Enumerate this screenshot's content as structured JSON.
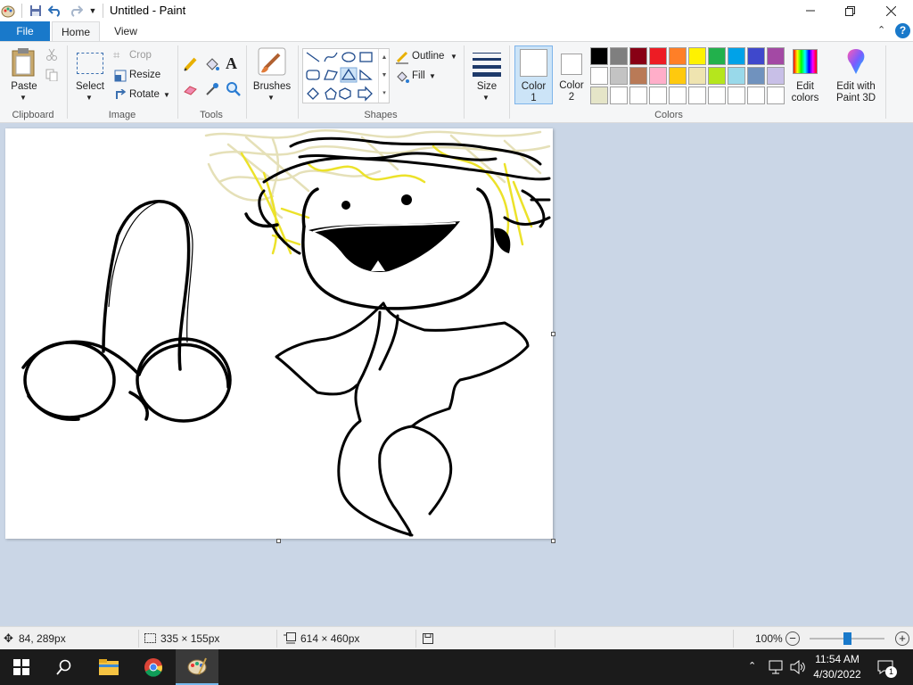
{
  "window": {
    "title": "Untitled - Paint",
    "quick_access": [
      "paint-app-icon",
      "save-icon",
      "undo-icon",
      "redo-icon",
      "customize-dropdown-icon"
    ],
    "controls": [
      "minimize",
      "maximize",
      "close"
    ]
  },
  "tabs": [
    {
      "label": "File",
      "active": false
    },
    {
      "label": "Home",
      "active": true
    },
    {
      "label": "View",
      "active": false
    }
  ],
  "ribbon": {
    "clipboard": {
      "group_label": "Clipboard",
      "paste_label": "Paste"
    },
    "image": {
      "group_label": "Image",
      "select_label": "Select",
      "crop_label": "Crop",
      "resize_label": "Resize",
      "rotate_label": "Rotate"
    },
    "tools": {
      "group_label": "Tools",
      "items": [
        "pencil",
        "fill",
        "text",
        "eraser",
        "color-picker",
        "magnifier"
      ]
    },
    "brushes": {
      "label": "Brushes"
    },
    "shapes": {
      "group_label": "Shapes",
      "outline_label": "Outline",
      "fill_label": "Fill"
    },
    "size": {
      "label": "Size"
    },
    "colors": {
      "group_label": "Colors",
      "color1_label": "Color",
      "color1_num": "1",
      "color2_label": "Color",
      "color2_num": "2",
      "color1": "#ffffff",
      "color2": "#ffffff",
      "palette_row1": [
        "#000000",
        "#7f7f7f",
        "#880015",
        "#ed1c24",
        "#ff7f27",
        "#fff200",
        "#22b14c",
        "#00a2e8",
        "#3f48cc",
        "#a349a4"
      ],
      "palette_row2": [
        "#ffffff",
        "#c3c3c3",
        "#b97a57",
        "#ffaec9",
        "#ffc90e",
        "#efe4b0",
        "#b5e61d",
        "#99d9ea",
        "#7092be",
        "#c8bfe7"
      ],
      "palette_row3": [
        "#e5e5c8",
        "#ffffff",
        "#ffffff",
        "#ffffff",
        "#ffffff",
        "#ffffff",
        "#ffffff",
        "#ffffff",
        "#ffffff",
        "#ffffff"
      ],
      "edit_colors_label": "Edit\ncolors",
      "edit_paint3d_label": "Edit with\nPaint 3D"
    }
  },
  "status": {
    "cursor_pos": "84, 289px",
    "selection_size": "335 × 155px",
    "image_size": "614 × 460px",
    "zoom": "100%",
    "zoom_fraction": 0.5
  },
  "taskbar": {
    "pinned": [
      "start-icon",
      "search-icon",
      "file-explorer-icon",
      "chrome-icon",
      "paint-icon"
    ],
    "time": "11:54 AM",
    "date": "4/30/2022",
    "notification_count": "1"
  }
}
